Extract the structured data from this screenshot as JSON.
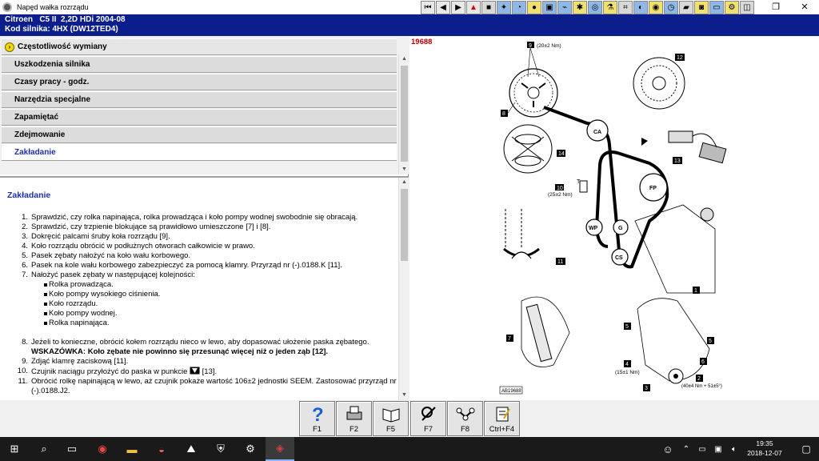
{
  "window": {
    "title": "Napęd wałka rozrządu",
    "toolbar_icon_names": [
      "first-icon",
      "prev-icon",
      "next-icon",
      "warning-icon",
      "tools-icon",
      "lift-icon",
      "gauge-icon",
      "info-icon",
      "ecu-icon",
      "wiring-icon",
      "spark-icon",
      "cam-icon",
      "flask-icon",
      "chassis-icon",
      "oil-icon",
      "wheel-icon",
      "timer-icon",
      "seat-icon",
      "car-icon",
      "body-icon",
      "engine-icon",
      "meter-icon"
    ]
  },
  "vehicle": {
    "line1": "Citroen   C5 II  2,2D HDi 2004-08",
    "line2": "Kod silnika: 4HX (DW12TED4)"
  },
  "menu": {
    "frequency": "Częstotliwość wymiany",
    "items": [
      "Uszkodzenia silnika",
      "Czasy pracy - godz.",
      "Narzędzia specjalne",
      "Zapamiętać",
      "Zdejmowanie",
      "Zakładanie"
    ]
  },
  "content": {
    "heading": "Zakładanie",
    "steps": [
      {
        "n": "1",
        "text": "Sprawdzić, czy rolka napinająca, rolka prowadząca i koło pompy wodnej swobodnie się obracają."
      },
      {
        "n": "2",
        "text": "Sprawdzić, czy trzpienie blokujące są prawidłowo umieszczone [7] i [8]."
      },
      {
        "n": "3",
        "text": "Dokręcić palcami śruby koła rozrządu [9]."
      },
      {
        "n": "4",
        "text": "Koło rozrządu obrócić w podłużnych otworach całkowicie w prawo."
      },
      {
        "n": "5",
        "text": "Pasek zębaty nałożyć na koło wału korbowego."
      },
      {
        "n": "6",
        "text": "Pasek na kole wału korbowego zabezpieczyć za pomocą klamry. Przyrząd nr (-).0188.K [11]."
      },
      {
        "n": "7",
        "text": "Nałożyć pasek zębaty w następującej kolejności:"
      }
    ],
    "sub_items": [
      "Rolka prowadząca.",
      "Koło pompy wysokiego ciśnienia.",
      "Koło rozrządu.",
      "Koło pompy wodnej.",
      "Rolka napinająca."
    ],
    "step8": {
      "n": "8",
      "text": "Jeżeli to konieczne, obrócić kołem rozrządu nieco w lewo, aby dopasować ułożenie paska zębatego."
    },
    "step8_warning": "WSKAZÓWKA: Koło zębate nie powinno się przesunąć więcej niż o jeden ząb [12].",
    "step9": {
      "n": "9",
      "text": "Zdjąć klamrę zaciskową [11]."
    },
    "step10": {
      "n": "10",
      "text_before": "Czujnik naciągu przyłożyć do paska w punkcie",
      "text_after": "[13]."
    },
    "step11": {
      "n": "11",
      "text": "Obrócić rolkę napinającą w lewo, aż czujnik pokaże wartość 106±2 jednostki SEEM. Zastosować przyrząd nr (-).0188.J2."
    }
  },
  "diagram": {
    "ref": "19688",
    "labels": {
      "bolt_spec": "9 (20±2 Nm)",
      "l9": "9",
      "torque_20": "(20±2 Nm)",
      "l8": "8",
      "l12": "12",
      "l14": "14",
      "l13": "13",
      "l11": "11",
      "l10": "10",
      "torque_25": "(25±2 Nm)",
      "l7": "7",
      "l1": "1",
      "l5": "5",
      "l5b": "5",
      "l6": "6",
      "l4": "4",
      "torque_15": "(15±1 Nm)",
      "l2": "2",
      "l3": "3",
      "torque_40": "(40±4 Nm + 51±5°)",
      "ca": "CA",
      "fp": "FP",
      "wp": "WP",
      "g": "G",
      "cs": "CS",
      "t": "T",
      "ab_main": "AB19688"
    }
  },
  "fkeys": [
    {
      "label": "F1",
      "icon": "help-icon"
    },
    {
      "label": "F2",
      "icon": "print-icon"
    },
    {
      "label": "F5",
      "icon": "book-icon"
    },
    {
      "label": "F7",
      "icon": "tools-icon"
    },
    {
      "label": "F8",
      "icon": "belt-icon"
    },
    {
      "label": "Ctrl+F4",
      "icon": "notes-icon"
    }
  ],
  "taskbar": {
    "time": "19:35",
    "date": "2018-12-07"
  }
}
